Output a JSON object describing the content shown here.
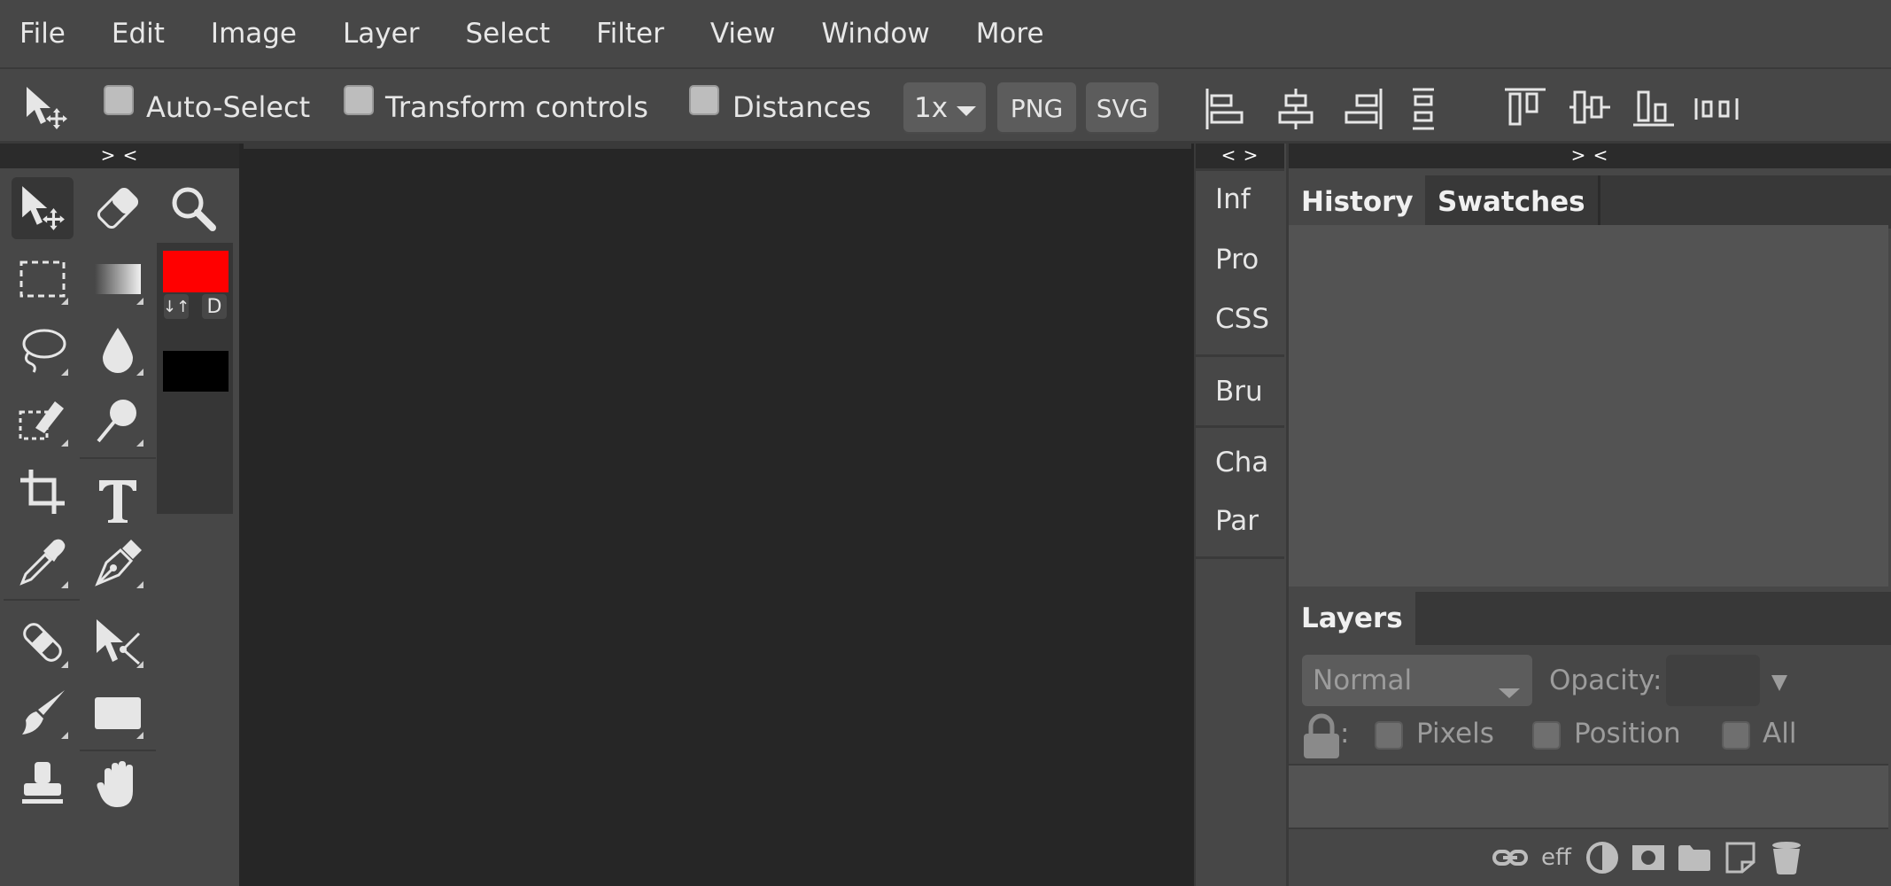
{
  "menu": [
    "File",
    "Edit",
    "Image",
    "Layer",
    "Select",
    "Filter",
    "View",
    "Window",
    "More"
  ],
  "options": {
    "auto_select": "Auto-Select",
    "transform_controls": "Transform controls",
    "distances": "Distances",
    "scale": "1x",
    "png": "PNG",
    "svg": "SVG"
  },
  "toolbar": {
    "collapse_left": "> <",
    "colors": {
      "foreground": "#ff0000",
      "background": "#000000",
      "swap_label": "↓↑",
      "default_label": "D"
    }
  },
  "midpanel": {
    "collapse": "< >",
    "items": [
      "Inf",
      "Pro",
      "CSS",
      "Bru",
      "Cha",
      "Par"
    ]
  },
  "rightpanel": {
    "collapse": "> <",
    "tabs_top": [
      "History",
      "Swatches"
    ],
    "tabs_bottom": [
      "Layers"
    ],
    "blend_mode": "Normal",
    "opacity_label": "Opacity:",
    "opacity_value": "",
    "lock_colon": ":",
    "lock_pixels": "Pixels",
    "lock_position": "Position",
    "lock_all": "All",
    "footer_eff": "eff"
  },
  "colors": {
    "accent_fg": "#ff0000",
    "panel_bg": "#474747",
    "canvas_bg": "#262626"
  }
}
